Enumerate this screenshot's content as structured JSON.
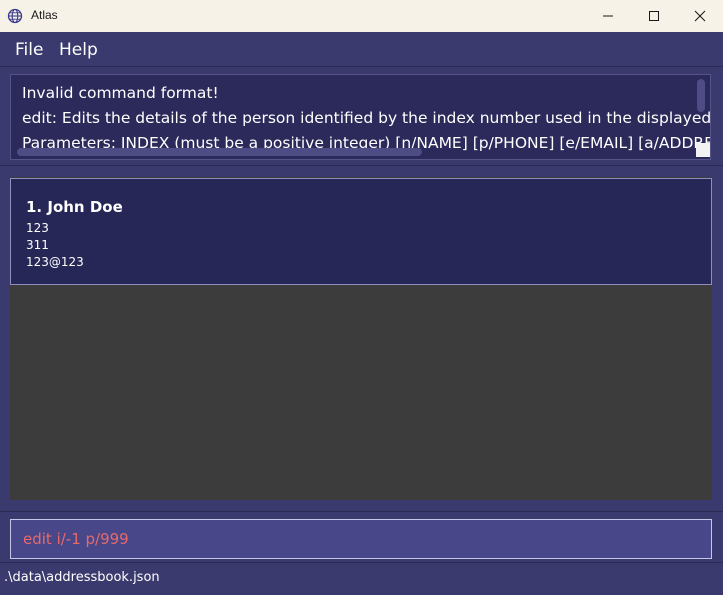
{
  "window": {
    "title": "Atlas",
    "icon": "globe-icon",
    "controls": {
      "minimize": "minimize-icon",
      "maximize": "maximize-icon",
      "close": "close-icon"
    }
  },
  "menu": {
    "file": "File",
    "help": "Help"
  },
  "result": {
    "lines": [
      "Invalid command format!",
      "edit: Edits the details of the person identified by the index number used in the displayed person list.",
      "Parameters: INDEX (must be a positive integer) [n/NAME] [p/PHONE] [e/EMAIL] [a/ADDRESS]"
    ]
  },
  "persons": [
    {
      "name": "1. John Doe",
      "phone": "123",
      "address": "311",
      "email": "123@123"
    }
  ],
  "command": {
    "value": "edit i/-1 p/999"
  },
  "status": {
    "path": ".\\data\\addressbook.json"
  },
  "colors": {
    "background": "#3b3a6e",
    "card": "#262657",
    "list_background": "#3c3c3c",
    "command_box": "#47478a",
    "error_text": "#e8696b"
  }
}
